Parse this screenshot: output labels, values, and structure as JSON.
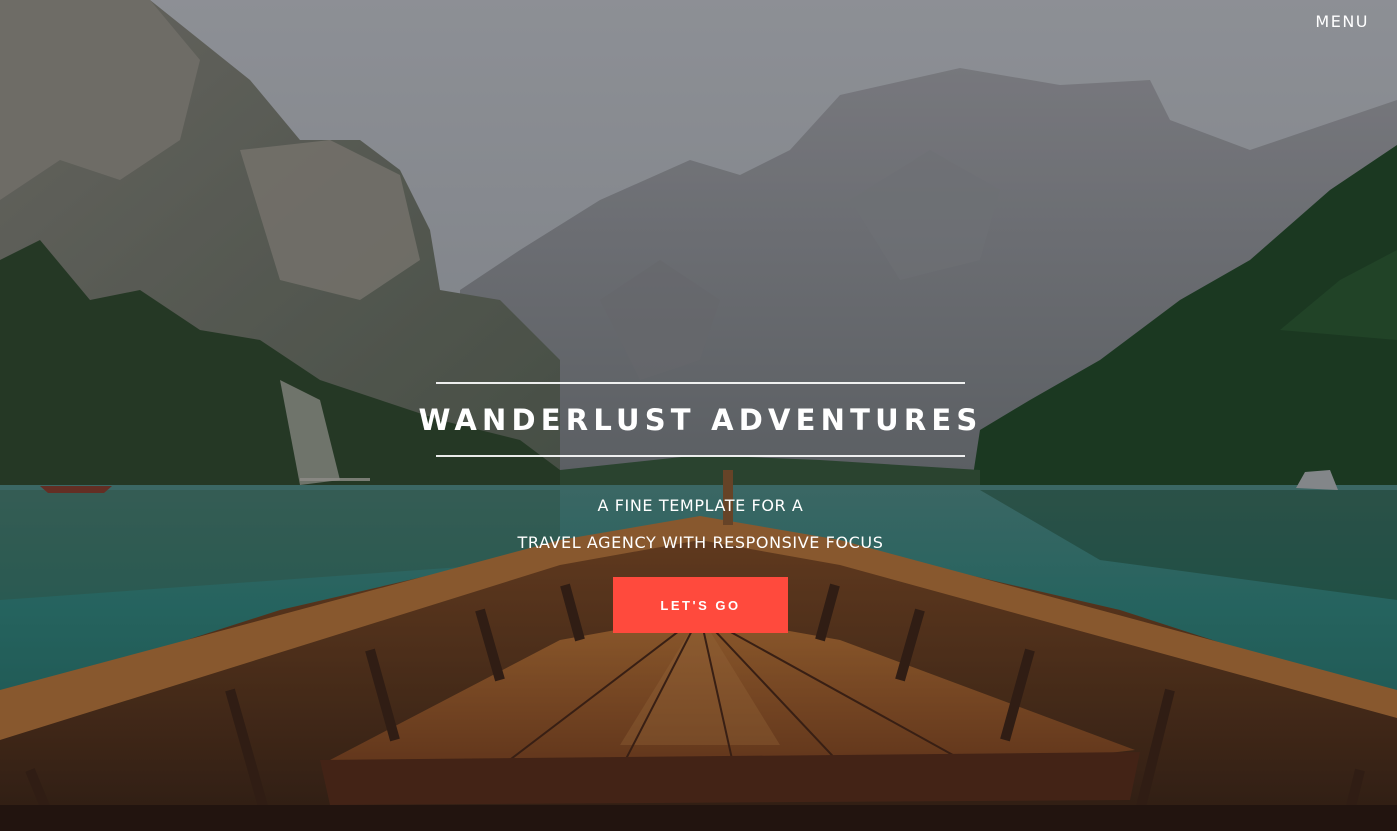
{
  "nav": {
    "menu_label": "MENU"
  },
  "hero": {
    "title": "WANDERLUST ADVENTURES",
    "subtitle_line1": "A FINE TEMPLATE FOR A",
    "subtitle_line2": "TRAVEL AGENCY WITH RESPONSIVE FOCUS",
    "cta_label": "LET'S GO"
  },
  "colors": {
    "accent": "#ff4a3d",
    "text": "#ffffff",
    "lake": "#2e8c82",
    "boat_wood": "#b5652a"
  }
}
